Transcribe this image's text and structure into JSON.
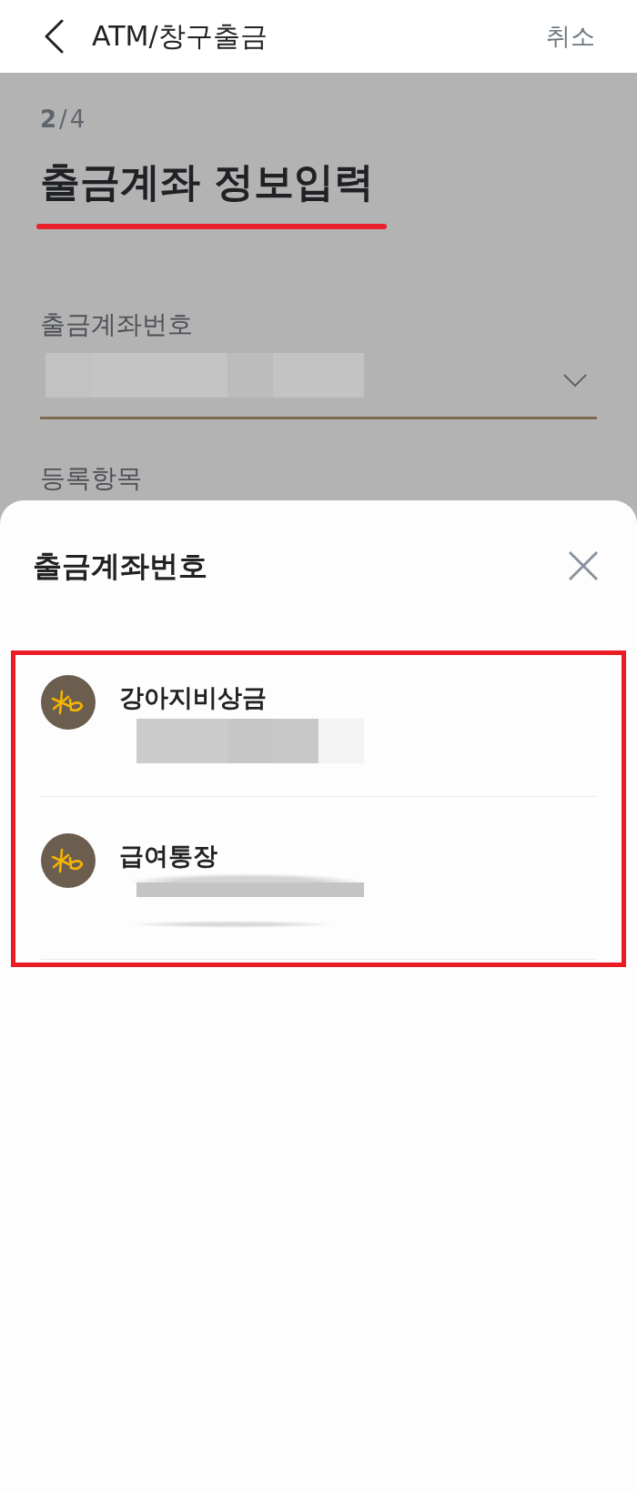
{
  "header": {
    "title": "ATM/창구출금",
    "cancel": "취소"
  },
  "step": "**2**/4",
  "heading": "출금계좌 정보입력",
  "fields": [
    {
      "kind": "select",
      "label": "출금계좌번호",
      "masked_value": {
        "kind": "blocks"
      }
    },
    {
      "kind": "label",
      "label": "등록항목"
    }
  ],
  "sheet": {
    "title": "출금계좌번호",
    "accounts": [
      {
        "name": "강아지비상금",
        "masked_value": {
          "kind": "blocks"
        }
      },
      {
        "name": "급여통장",
        "masked_value": {
          "kind": "smudge"
        }
      }
    ]
  }
}
